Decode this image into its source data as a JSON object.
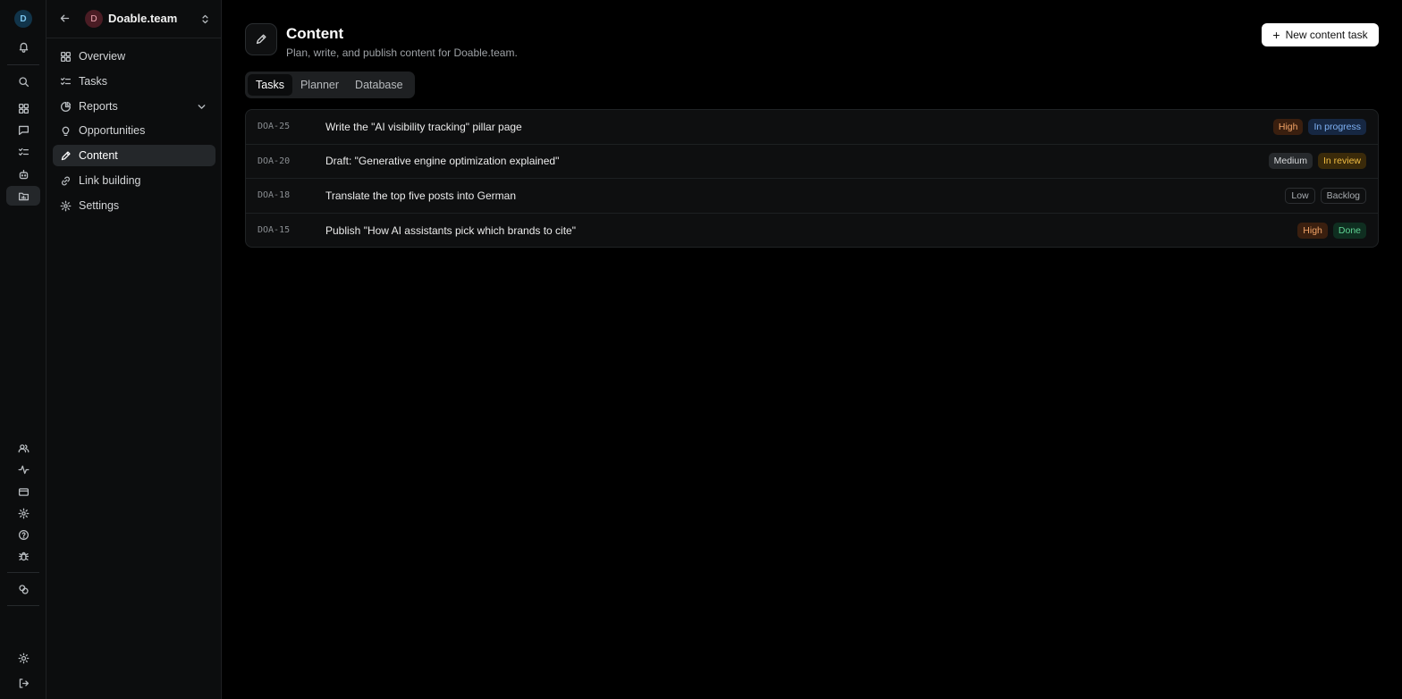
{
  "rail": {
    "avatar": "D",
    "icons": [
      "bell-icon",
      "search-icon",
      "grid-icon",
      "chat-icon",
      "list-check-icon",
      "bot-icon",
      "folder-chart-icon",
      "users-icon",
      "activity-icon",
      "credit-card-icon",
      "gear-icon",
      "help-icon",
      "bug-icon",
      "link-icon",
      "sun-icon",
      "logout-icon"
    ]
  },
  "nav": {
    "team_initial": "D",
    "team_name": "Doable.team",
    "items": [
      {
        "label": "Overview",
        "icon": "grid-icon"
      },
      {
        "label": "Tasks",
        "icon": "list-check-icon"
      },
      {
        "label": "Reports",
        "icon": "pie-chart-icon"
      },
      {
        "label": "Opportunities",
        "icon": "lightbulb-icon"
      },
      {
        "label": "Content",
        "icon": "pencil-icon"
      },
      {
        "label": "Link building",
        "icon": "link-icon"
      },
      {
        "label": "Settings",
        "icon": "gear-icon"
      }
    ]
  },
  "page": {
    "title": "Content",
    "subtitle": "Plan, write, and publish content for Doable.team.",
    "new_button": "New content task"
  },
  "tabs": [
    "Tasks",
    "Planner",
    "Database"
  ],
  "active_tab": "Tasks",
  "tasks": [
    {
      "id": "DOA-25",
      "title": "Write the \"AI visibility tracking\" pillar page",
      "priority": "High",
      "status": "In progress"
    },
    {
      "id": "DOA-20",
      "title": "Draft: \"Generative engine optimization explained\"",
      "priority": "Medium",
      "status": "In review"
    },
    {
      "id": "DOA-18",
      "title": "Translate the top five posts into German",
      "priority": "Low",
      "status": "Backlog"
    },
    {
      "id": "DOA-15",
      "title": "Publish \"How AI assistants pick which brands to cite\"",
      "priority": "High",
      "status": "Done"
    }
  ],
  "colors": {
    "background": "#000000",
    "sidebar": "#0c0d0e",
    "active_item": "#24272a",
    "priority_high": "#f2a366",
    "status_in_progress": "#7fb2f5",
    "status_in_review": "#f2bd42",
    "status_done": "#5fd393"
  }
}
